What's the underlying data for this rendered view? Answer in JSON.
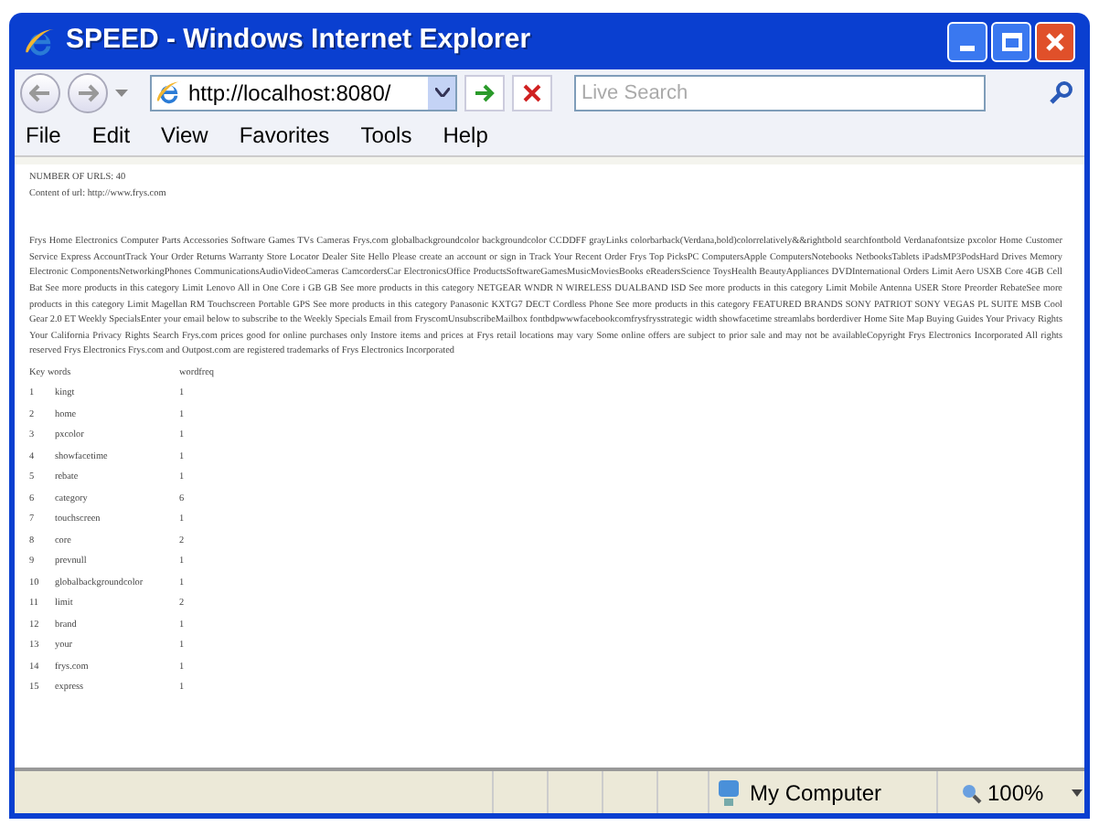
{
  "window": {
    "title": "SPEED - Windows Internet Explorer"
  },
  "address_bar": {
    "value": "http://localhost:8080/"
  },
  "search": {
    "placeholder": "Live Search"
  },
  "menu": [
    "File",
    "Edit",
    "View",
    "Favorites",
    "Tools",
    "Help"
  ],
  "page": {
    "url_count": "NUMBER OF URLS: 40",
    "content_url": "Content of url: http://www.frys.com",
    "content": "Frys Home Electronics Computer Parts Accessories Software Games TVs Cameras Frys.com globalbackgroundcolor backgroundcolor CCDDFF grayLinks colorbarback(Verdana,bold)colorrelatively&&rightbold searchfontbold Verdanafontsize pxcolor Home Customer Service Express AccountTrack Your Order Returns Warranty Store Locator Dealer Site Hello Please create an account or sign in Track Your Recent Order Frys Top PicksPC ComputersApple ComputersNotebooks NetbooksTablets iPadsMP3PodsHard Drives Memory Electronic ComponentsNetworkingPhones CommunicationsAudioVideoCameras CamcordersCar ElectronicsOffice ProductsSoftwareGamesMusicMoviesBooks eReadersScience ToysHealth BeautyAppliances DVDInternational Orders Limit Aero USXB Core 4GB Cell Bat See more products in this category Limit Lenovo All in One Core i GB GB See more products in this category NETGEAR WNDR N WIRELESS DUALBAND ISD See more products in this category Limit Mobile Antenna USER Store Preorder RebateSee more products in this category Limit Magellan RM Touchscreen Portable GPS See more products in this category Panasonic KXTG7 DECT Cordless Phone See more products in this category FEATURED BRANDS SONY PATRIOT SONY VEGAS PL SUITE MSB Cool Gear 2.0 ET Weekly SpecialsEnter your email below to subscribe to the Weekly Specials Email from FryscomUnsubscribeMailbox fontbdpwwwfacebookcomfrysfrysstrategic width showfacetime streamlabs borderdiver Home Site Map Buying Guides Your Privacy Rights Your California Privacy Rights Search Frys.com prices good for online purchases only Instore items and prices at Frys retail locations may vary Some online offers are subject to prior sale and may not be availableCopyright Frys Electronics Incorporated All rights reserved Frys Electronics Frys.com and Outpost.com are registered trademarks of Frys Electronics Incorporated"
  },
  "table": {
    "columns": [
      "Key words",
      "wordfreq"
    ],
    "rows": [
      {
        "index": "1",
        "word": "kingt",
        "freq": "1"
      },
      {
        "index": "2",
        "word": "home",
        "freq": "1"
      },
      {
        "index": "3",
        "word": "pxcolor",
        "freq": "1"
      },
      {
        "index": "4",
        "word": "showfacetime",
        "freq": "1"
      },
      {
        "index": "5",
        "word": "rebate",
        "freq": "1"
      },
      {
        "index": "6",
        "word": "category",
        "freq": "6"
      },
      {
        "index": "7",
        "word": "touchscreen",
        "freq": "1"
      },
      {
        "index": "8",
        "word": "core",
        "freq": "2"
      },
      {
        "index": "9",
        "word": "prevnull",
        "freq": "1"
      },
      {
        "index": "10",
        "word": "globalbackgroundcolor",
        "freq": "1"
      },
      {
        "index": "11",
        "word": "limit",
        "freq": "2"
      },
      {
        "index": "12",
        "word": "brand",
        "freq": "1"
      },
      {
        "index": "13",
        "word": "your",
        "freq": "1"
      },
      {
        "index": "14",
        "word": "frys.com",
        "freq": "1"
      },
      {
        "index": "15",
        "word": "express",
        "freq": "1"
      }
    ]
  },
  "status_bar": {
    "zone": "My Computer",
    "zoom": "100%"
  }
}
